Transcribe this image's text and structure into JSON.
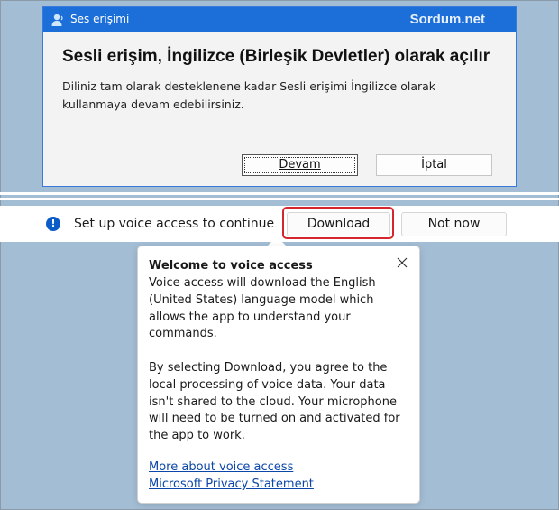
{
  "dialog": {
    "title": "Ses erişimi",
    "watermark": "Sordum.net",
    "heading": "Sesli erişim, İngilizce (Birleşik Devletler) olarak açılır",
    "body": "Diliniz tam olarak desteklenene kadar Sesli erişimi İngilizce olarak kullanmaya devam edebilirsiniz.",
    "primary_button": "Devam",
    "secondary_button": "İptal"
  },
  "notification": {
    "icon": "info-icon",
    "message": "Set up voice access to continue",
    "download_button": "Download",
    "not_now_button": "Not now"
  },
  "popup": {
    "title": "Welcome to voice access",
    "paragraph1": "Voice access will download the English (United States) language model which allows the app to understand your commands.",
    "paragraph2": "By selecting Download, you agree to the local processing of voice data. Your data isn't shared to the cloud. Your microphone will need to be turned on and activated for the app to work.",
    "link_more": "More about voice access",
    "link_privacy": "Microsoft Privacy Statement"
  },
  "colors": {
    "desktop_background": "#a3bdd4",
    "titlebar": "#1c6fd9",
    "highlight": "#d6262d",
    "link": "#0b47a8"
  }
}
